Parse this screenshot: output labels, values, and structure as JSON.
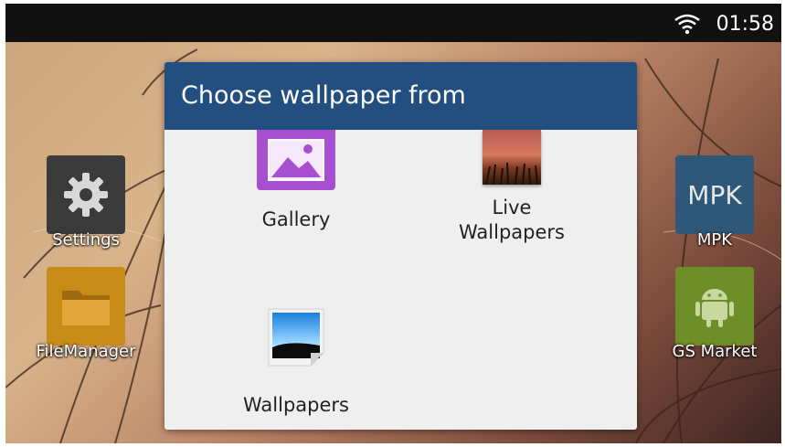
{
  "status_bar": {
    "time": "01:58",
    "icon": "wifi-icon"
  },
  "home_apps": {
    "settings": {
      "label": "Settings",
      "icon": "gear-icon"
    },
    "file_manager": {
      "label": "FileManager",
      "icon": "folder-icon"
    },
    "mpk": {
      "label": "MPK",
      "tile_text": "MPK"
    },
    "gs_market": {
      "label": "GS Market",
      "icon": "android-icon"
    }
  },
  "dialog": {
    "title": "Choose wallpaper from",
    "options": [
      {
        "label": "Gallery",
        "icon": "gallery-icon"
      },
      {
        "label_line1": "Live",
        "label_line2": "Wallpapers",
        "icon": "live-wallpapers-icon"
      },
      {
        "label": "Wallpapers",
        "icon": "wallpapers-icon"
      }
    ]
  },
  "colors": {
    "dialog_header": "#224f80",
    "dialog_body": "#efefef",
    "gallery": "#a64fd1",
    "mpk_tile": "#2f5878",
    "android_tile": "#6e8e28"
  }
}
